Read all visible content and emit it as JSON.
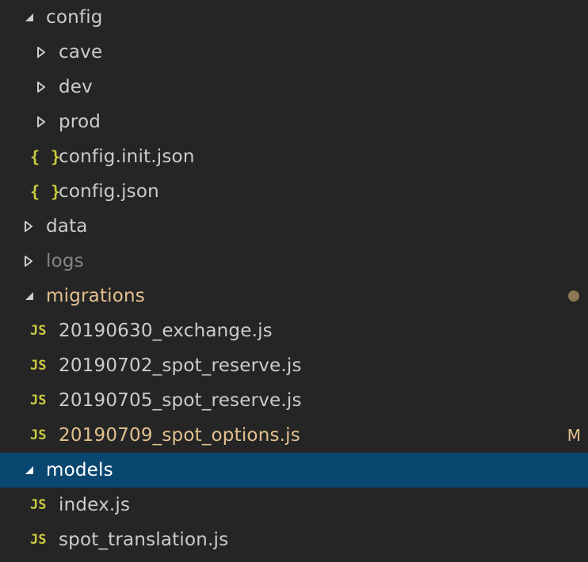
{
  "explorer": {
    "items": [
      {
        "label": "config",
        "kind": "folder",
        "expanded": true
      },
      {
        "label": "cave",
        "kind": "folder",
        "expanded": false
      },
      {
        "label": "dev",
        "kind": "folder",
        "expanded": false
      },
      {
        "label": "prod",
        "kind": "folder",
        "expanded": false
      },
      {
        "label": "config.init.json",
        "kind": "file",
        "icon": "{ }",
        "icon_name": "json-icon"
      },
      {
        "label": "config.json",
        "kind": "file",
        "icon": "{ }",
        "icon_name": "json-icon"
      },
      {
        "label": "data",
        "kind": "folder",
        "expanded": false
      },
      {
        "label": "logs",
        "kind": "folder",
        "expanded": false,
        "ignored": true
      },
      {
        "label": "migrations",
        "kind": "folder",
        "expanded": true,
        "modified": true,
        "badge": "dot"
      },
      {
        "label": "20190630_exchange.js",
        "kind": "file",
        "icon": "JS",
        "icon_name": "javascript-icon"
      },
      {
        "label": "20190702_spot_reserve.js",
        "kind": "file",
        "icon": "JS",
        "icon_name": "javascript-icon"
      },
      {
        "label": "20190705_spot_reserve.js",
        "kind": "file",
        "icon": "JS",
        "icon_name": "javascript-icon"
      },
      {
        "label": "20190709_spot_options.js",
        "kind": "file",
        "icon": "JS",
        "icon_name": "javascript-icon",
        "modified": true,
        "badge": "M"
      },
      {
        "label": "models",
        "kind": "folder",
        "expanded": true,
        "selected": true
      },
      {
        "label": "index.js",
        "kind": "file",
        "icon": "JS",
        "icon_name": "javascript-icon"
      },
      {
        "label": "spot_translation.js",
        "kind": "file",
        "icon": "JS",
        "icon_name": "javascript-icon"
      }
    ]
  },
  "colors": {
    "background": "#252526",
    "selection": "#094771",
    "text": "#cccccc",
    "ignored_text": "#858585",
    "modified_text": "#e2c08d",
    "icon_yellow": "#cbcb41",
    "badge_dot": "#8f7751"
  }
}
